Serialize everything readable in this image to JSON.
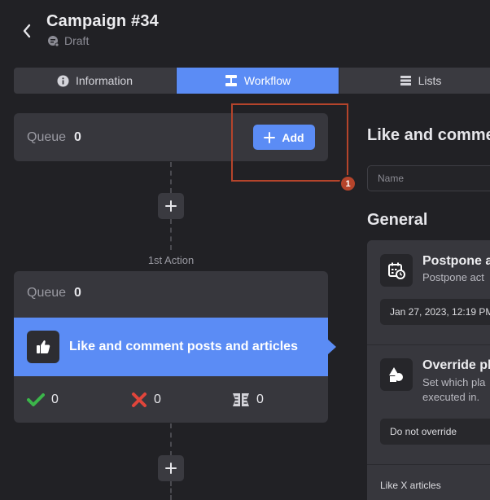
{
  "header": {
    "back_icon": "chevron-left-icon",
    "title": "Campaign #34",
    "status": "Draft",
    "status_icon": "draft-status-icon"
  },
  "tabs": [
    {
      "label": "Information",
      "icon": "info-icon",
      "active": false
    },
    {
      "label": "Workflow",
      "icon": "workflow-icon",
      "active": true
    },
    {
      "label": "Lists",
      "icon": "list-icon",
      "active": false
    }
  ],
  "queue": {
    "label": "Queue",
    "count": "0",
    "add_label": "Add"
  },
  "annotation": {
    "number": "1",
    "color": "#b5442b"
  },
  "action": {
    "step_label": "1st Action",
    "queue_label": "Queue",
    "queue_count": "0",
    "title": "Like and comment posts and articles",
    "success_count": "0",
    "failed_count": "0",
    "skipped_count": "0"
  },
  "right_panel": {
    "title": "Like and comme",
    "name_placeholder": "Name",
    "section_title": "General",
    "postpone": {
      "title": "Postpone a",
      "desc": "Postpone act",
      "value": "Jan 27, 2023, 12:19 PM"
    },
    "override": {
      "title": "Override pl",
      "desc_line1": "Set which pla",
      "desc_line2": "executed in.",
      "value": "Do not override"
    },
    "like_x_label": "Like X articles"
  },
  "colors": {
    "accent": "#5b8cf5",
    "background": "#212125",
    "card": "#37373d",
    "success": "#3bb54a",
    "danger": "#e0453b"
  }
}
